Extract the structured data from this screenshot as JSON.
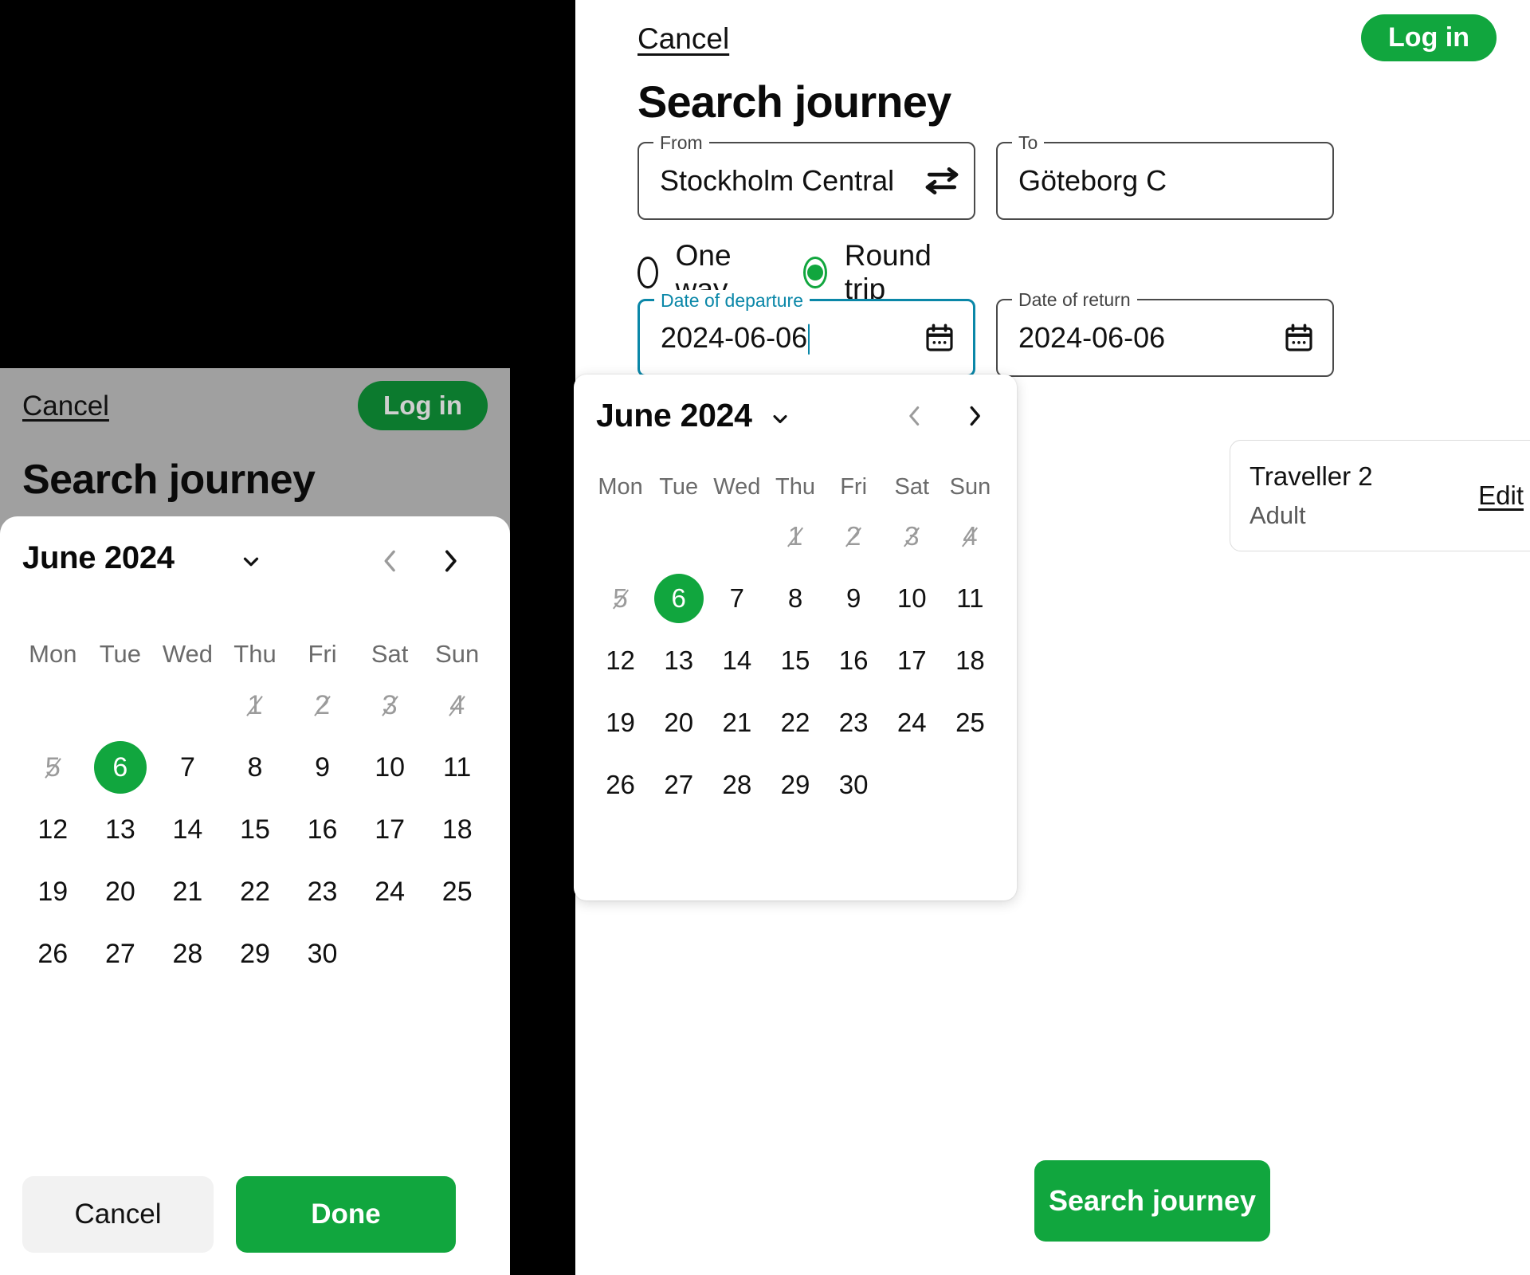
{
  "mobile": {
    "topbar": {
      "cancel_label": "Cancel",
      "login_label": "Log in"
    },
    "page_title": "Search journey",
    "calendar": {
      "month_label": "June 2024",
      "month_dropdown_icon": "chevron-down-icon",
      "prev_icon": "chevron-left-icon",
      "next_icon": "chevron-right-icon",
      "day_names": [
        "Mon",
        "Tue",
        "Wed",
        "Thu",
        "Fri",
        "Sat",
        "Sun"
      ],
      "leading_blanks": 3,
      "days": [
        {
          "n": "1",
          "state": "disabled"
        },
        {
          "n": "2",
          "state": "disabled"
        },
        {
          "n": "3",
          "state": "disabled"
        },
        {
          "n": "4",
          "state": "disabled"
        },
        {
          "n": "5",
          "state": "disabled"
        },
        {
          "n": "6",
          "state": "selected"
        },
        {
          "n": "7",
          "state": "normal"
        },
        {
          "n": "8",
          "state": "normal"
        },
        {
          "n": "9",
          "state": "normal"
        },
        {
          "n": "10",
          "state": "normal"
        },
        {
          "n": "11",
          "state": "normal"
        },
        {
          "n": "12",
          "state": "normal"
        },
        {
          "n": "13",
          "state": "normal"
        },
        {
          "n": "14",
          "state": "normal"
        },
        {
          "n": "15",
          "state": "normal"
        },
        {
          "n": "16",
          "state": "normal"
        },
        {
          "n": "17",
          "state": "normal"
        },
        {
          "n": "18",
          "state": "normal"
        },
        {
          "n": "19",
          "state": "normal"
        },
        {
          "n": "20",
          "state": "normal"
        },
        {
          "n": "21",
          "state": "normal"
        },
        {
          "n": "22",
          "state": "normal"
        },
        {
          "n": "23",
          "state": "normal"
        },
        {
          "n": "24",
          "state": "normal"
        },
        {
          "n": "25",
          "state": "normal"
        },
        {
          "n": "26",
          "state": "normal"
        },
        {
          "n": "27",
          "state": "normal"
        },
        {
          "n": "28",
          "state": "normal"
        },
        {
          "n": "29",
          "state": "normal"
        },
        {
          "n": "30",
          "state": "normal"
        }
      ]
    },
    "footer": {
      "cancel_label": "Cancel",
      "done_label": "Done"
    }
  },
  "desktop": {
    "topbar": {
      "cancel_label": "Cancel",
      "login_label": "Log in"
    },
    "page_title": "Search journey",
    "from": {
      "legend": "From",
      "value": "Stockholm Central"
    },
    "to": {
      "legend": "To",
      "value": "Göteborg C"
    },
    "swap_icon": "swap-arrows-icon",
    "trip_type": {
      "one_way_label": "One way",
      "round_trip_label": "Round trip",
      "selected": "Round trip"
    },
    "date_departure": {
      "legend": "Date of departure",
      "value": "2024-06-06",
      "icon": "calendar-icon",
      "focused": true
    },
    "date_return": {
      "legend": "Date of return",
      "value": "2024-06-06",
      "icon": "calendar-icon",
      "focused": false
    },
    "traveller": {
      "name": "Traveller 2",
      "type": "Adult",
      "edit_label": "Edit"
    },
    "calendar": {
      "month_label": "June 2024",
      "month_dropdown_icon": "chevron-down-icon",
      "prev_icon": "chevron-left-icon",
      "next_icon": "chevron-right-icon",
      "day_names": [
        "Mon",
        "Tue",
        "Wed",
        "Thu",
        "Fri",
        "Sat",
        "Sun"
      ],
      "leading_blanks": 3,
      "days": [
        {
          "n": "1",
          "state": "disabled"
        },
        {
          "n": "2",
          "state": "disabled"
        },
        {
          "n": "3",
          "state": "disabled"
        },
        {
          "n": "4",
          "state": "disabled"
        },
        {
          "n": "5",
          "state": "disabled"
        },
        {
          "n": "6",
          "state": "selected"
        },
        {
          "n": "7",
          "state": "normal"
        },
        {
          "n": "8",
          "state": "normal"
        },
        {
          "n": "9",
          "state": "normal"
        },
        {
          "n": "10",
          "state": "normal"
        },
        {
          "n": "11",
          "state": "normal"
        },
        {
          "n": "12",
          "state": "normal"
        },
        {
          "n": "13",
          "state": "normal"
        },
        {
          "n": "14",
          "state": "normal"
        },
        {
          "n": "15",
          "state": "normal"
        },
        {
          "n": "16",
          "state": "normal"
        },
        {
          "n": "17",
          "state": "normal"
        },
        {
          "n": "18",
          "state": "normal"
        },
        {
          "n": "19",
          "state": "normal"
        },
        {
          "n": "20",
          "state": "normal"
        },
        {
          "n": "21",
          "state": "normal"
        },
        {
          "n": "22",
          "state": "normal"
        },
        {
          "n": "23",
          "state": "normal"
        },
        {
          "n": "24",
          "state": "normal"
        },
        {
          "n": "25",
          "state": "normal"
        },
        {
          "n": "26",
          "state": "normal"
        },
        {
          "n": "27",
          "state": "normal"
        },
        {
          "n": "28",
          "state": "normal"
        },
        {
          "n": "29",
          "state": "normal"
        },
        {
          "n": "30",
          "state": "normal"
        }
      ]
    },
    "search_button_label": "Search journey"
  },
  "colors": {
    "brand_green": "#11a63e",
    "brand_green_dim": "#0c7a2e",
    "focus_teal": "#0a87a8",
    "scrim_gray": "#a0a0a0",
    "disabled_gray": "#9b9b9b"
  }
}
